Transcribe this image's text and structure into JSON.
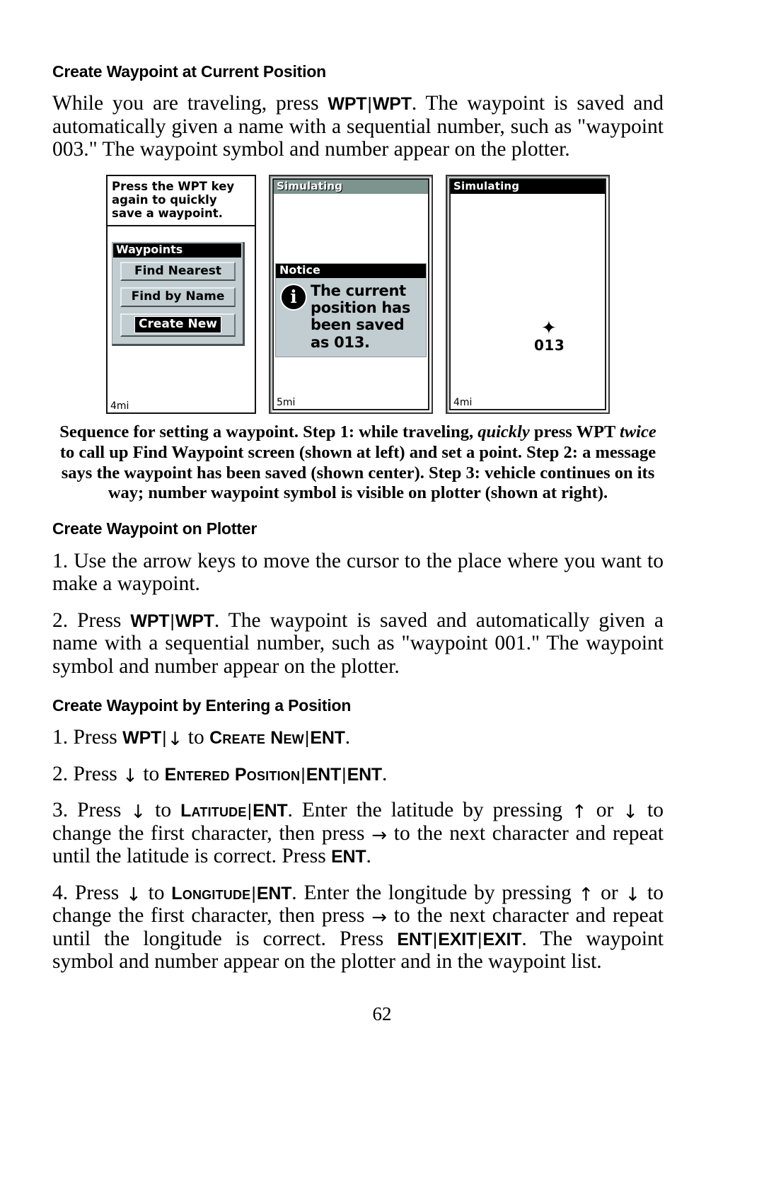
{
  "page": {
    "number": "62"
  },
  "sections": {
    "heading1": "Create Waypoint at Current Position",
    "heading2": "Create Waypoint on Plotter",
    "heading3": "Create Waypoint by Entering a Position"
  },
  "intro": {
    "part1": "While you are traveling, press ",
    "key_a": "WPT",
    "separator": "|",
    "key_b": "WPT",
    "part2": ". The waypoint is saved and automatically given a name with a sequential number, such as \"waypoint 003.\" The waypoint symbol and number appear on the plotter."
  },
  "figure": {
    "panel1": {
      "tip_text": "Press the WPT key again to quickly save a waypoint.",
      "menu_title": "Waypoints",
      "buttons": [
        {
          "label": "Find Nearest",
          "highlighted": false
        },
        {
          "label": "Find by Name",
          "highlighted": false
        },
        {
          "label": "Create New",
          "highlighted": true
        }
      ],
      "scale": "4mi"
    },
    "panel2": {
      "titlebar": "Simulating",
      "notice_title": "Notice",
      "notice_text": "The current position has been saved as 013.",
      "icon": "info-icon",
      "scale": "5mi"
    },
    "panel3": {
      "titlebar": "Simulating",
      "waypoint_number": "013",
      "waypoint_symbol": "✦",
      "scale": "4mi"
    }
  },
  "caption": {
    "t1": "Sequence for setting a waypoint. Step 1: while traveling, ",
    "i1": "quickly",
    "t2": " press WPT ",
    "i2": "twice",
    "t3": " to call up Find Waypoint screen (shown at left) and set a point. Step 2: a message says the waypoint has been saved (shown center). Step 3: vehicle continues on its way; number waypoint symbol is visible on plotter (shown at right)."
  },
  "plotter_steps": {
    "step1": "1. Use the arrow keys to move the cursor to the place where you want to make a waypoint.",
    "step2_pre": "2. Press ",
    "step2_key_a": "WPT",
    "step2_sep": "|",
    "step2_key_b": "WPT",
    "step2_post": ". The waypoint is saved and automatically given a name with a sequential number, such as \"waypoint 001.\" The waypoint symbol and number appear on the plotter."
  },
  "position_steps": {
    "s1": {
      "pre": "1. Press ",
      "k1": "WPT",
      "sep1": "|",
      "arrow1": "↓",
      "mid": " to ",
      "sc1": "Create New",
      "sep2": "|",
      "k2": "ENT",
      "post": "."
    },
    "s2": {
      "pre": "2. Press ",
      "arrow1": "↓",
      "mid": " to ",
      "sc1": "Entered Position",
      "sep1": "|",
      "k1": "ENT",
      "sep2": "|",
      "k2": "ENT",
      "post": "."
    },
    "s3": {
      "pre": "3. Press ",
      "arrow1": "↓",
      "mid1": " to ",
      "sc1": "Latitude",
      "sep1": "|",
      "k1": "ENT",
      "mid2": ". Enter the latitude by pressing ",
      "arrow2": "↑",
      "mid3": " or ",
      "arrow3": "↓",
      "mid4": " to change the first character, then press ",
      "arrow4": "→",
      "mid5": " to the next character and repeat until the latitude is correct. Press ",
      "k2": "ENT",
      "post": "."
    },
    "s4": {
      "pre": "4. Press ",
      "arrow1": "↓",
      "mid1": " to ",
      "sc1": "Longitude",
      "sep1": "|",
      "k1": "ENT",
      "mid2": ". Enter the longitude by pressing ",
      "arrow2": "↑",
      "mid3": " or ",
      "arrow3": "↓",
      "mid4": " to change the first character, then press ",
      "arrow4": "→",
      "mid5": " to the next character and repeat until the longitude is correct. Press ",
      "k2": "ENT",
      "sep2": "|",
      "k3": "EXIT",
      "sep3": "|",
      "k4": "EXIT",
      "post": ". The waypoint symbol and number appear on the plotter and in the waypoint list."
    }
  },
  "colors": {
    "lcd_bg": "#c2cdd1",
    "titlebar_green": "#7d938d",
    "titlebar_black": "#000000"
  }
}
